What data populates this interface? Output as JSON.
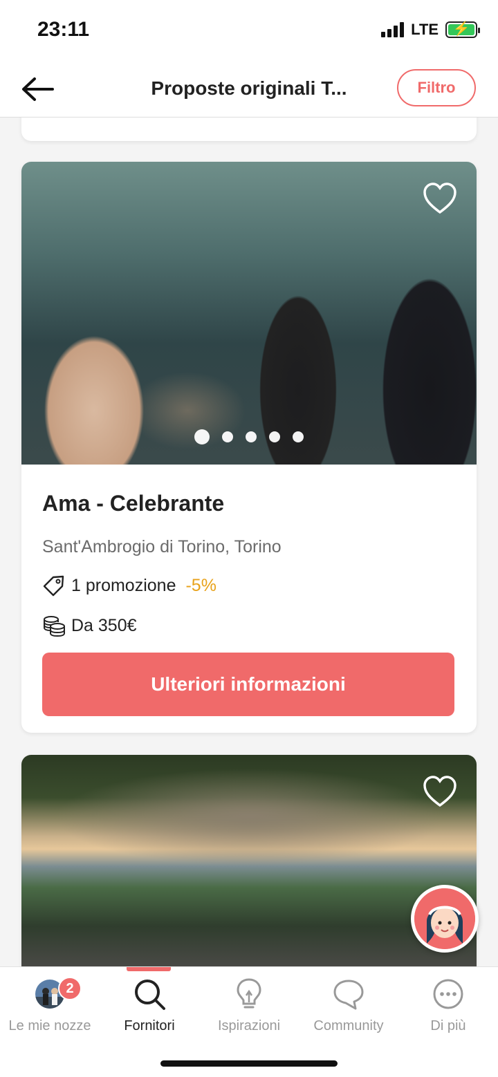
{
  "status": {
    "time": "23:11",
    "network": "LTE"
  },
  "header": {
    "title": "Proposte originali T...",
    "filter_label": "Filtro"
  },
  "vendors": [
    {
      "name": "Ama - Celebrante",
      "location": "Sant'Ambrogio di Torino, Torino",
      "promo": "1 promozione",
      "discount": "-5%",
      "price": "Da 350€",
      "cta": "Ulteriori informazioni",
      "photo_count": 5,
      "active_photo": 1
    }
  ],
  "tabs": [
    {
      "label": "Le mie nozze",
      "badge": "2",
      "icon": "avatar-icon"
    },
    {
      "label": "Fornitori",
      "icon": "search-icon",
      "active": true
    },
    {
      "label": "Ispirazioni",
      "icon": "lightbulb-icon"
    },
    {
      "label": "Community",
      "icon": "chat-bubble-icon"
    },
    {
      "label": "Di più",
      "icon": "more-dots-icon"
    }
  ],
  "colors": {
    "accent": "#f06a6a",
    "discount": "#e8a21a"
  }
}
